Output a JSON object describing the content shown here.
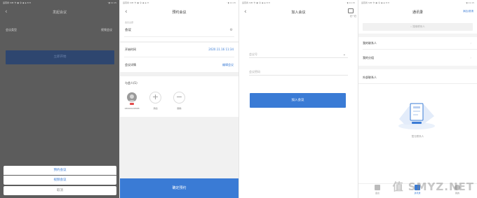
{
  "status": {
    "p1_left": "运营商 SIM 卡 ▣ 令 ◉ ◈ 8 ✉",
    "p2_left": "运营商 SIM 卡 ▣ 令 ◉ ◈ ✉",
    "p3_left": "运营商 SIM 卡 ▣ 令 ◉ ◈ 8 ✉",
    "p4_left": "运营商 SIM 卡 ▣ 令 ◉ ◈ 8 ✉",
    "right": "ʼ ▮ 11:15"
  },
  "p1": {
    "title": "发起会议",
    "row_left": "会议类型",
    "row_right": "视频会议",
    "start_button": "立即开始",
    "sheet": [
      "预约会议",
      "视频会议"
    ],
    "cancel": "取消"
  },
  "p2": {
    "title": "预约会议",
    "subject_label": "会议主题",
    "subject_value": "会议",
    "start_label": "开始时间",
    "start_value": "2020.11.16 11:34",
    "details_label": "会议详情",
    "details_value": "编辑会议",
    "participants_label": "与会人(1)",
    "participant_name": "18000026588",
    "add_label": "添加",
    "remove_label": "删除",
    "confirm": "确定预约"
  },
  "p3": {
    "title": "加入会议",
    "scan_label": "扫一扫",
    "meeting_id_placeholder": "会议号",
    "password_placeholder": "会议密码",
    "join_button": "加入会议"
  },
  "p4": {
    "title": "通讯录",
    "right_action": "添加/邀请",
    "search_placeholder": "搜索联系人",
    "rows": [
      "我的联系人",
      "我的分组",
      "外部联系人"
    ],
    "empty_text": "暂无联系人",
    "tabs": [
      "会议",
      "通讯录",
      "我的"
    ]
  },
  "watermark": "值 SMYZ.NET",
  "colors": {
    "accent": "#3a7bd5",
    "danger": "#e34b4b",
    "overlay": "#5c5c5c"
  },
  "icons": [
    "back-arrow-icon",
    "settings-icon",
    "chevron-down-icon",
    "chevron-right-icon",
    "scan-icon",
    "search-icon",
    "plus-icon",
    "minus-icon",
    "avatar-icon",
    "contacts-empty-icon"
  ]
}
